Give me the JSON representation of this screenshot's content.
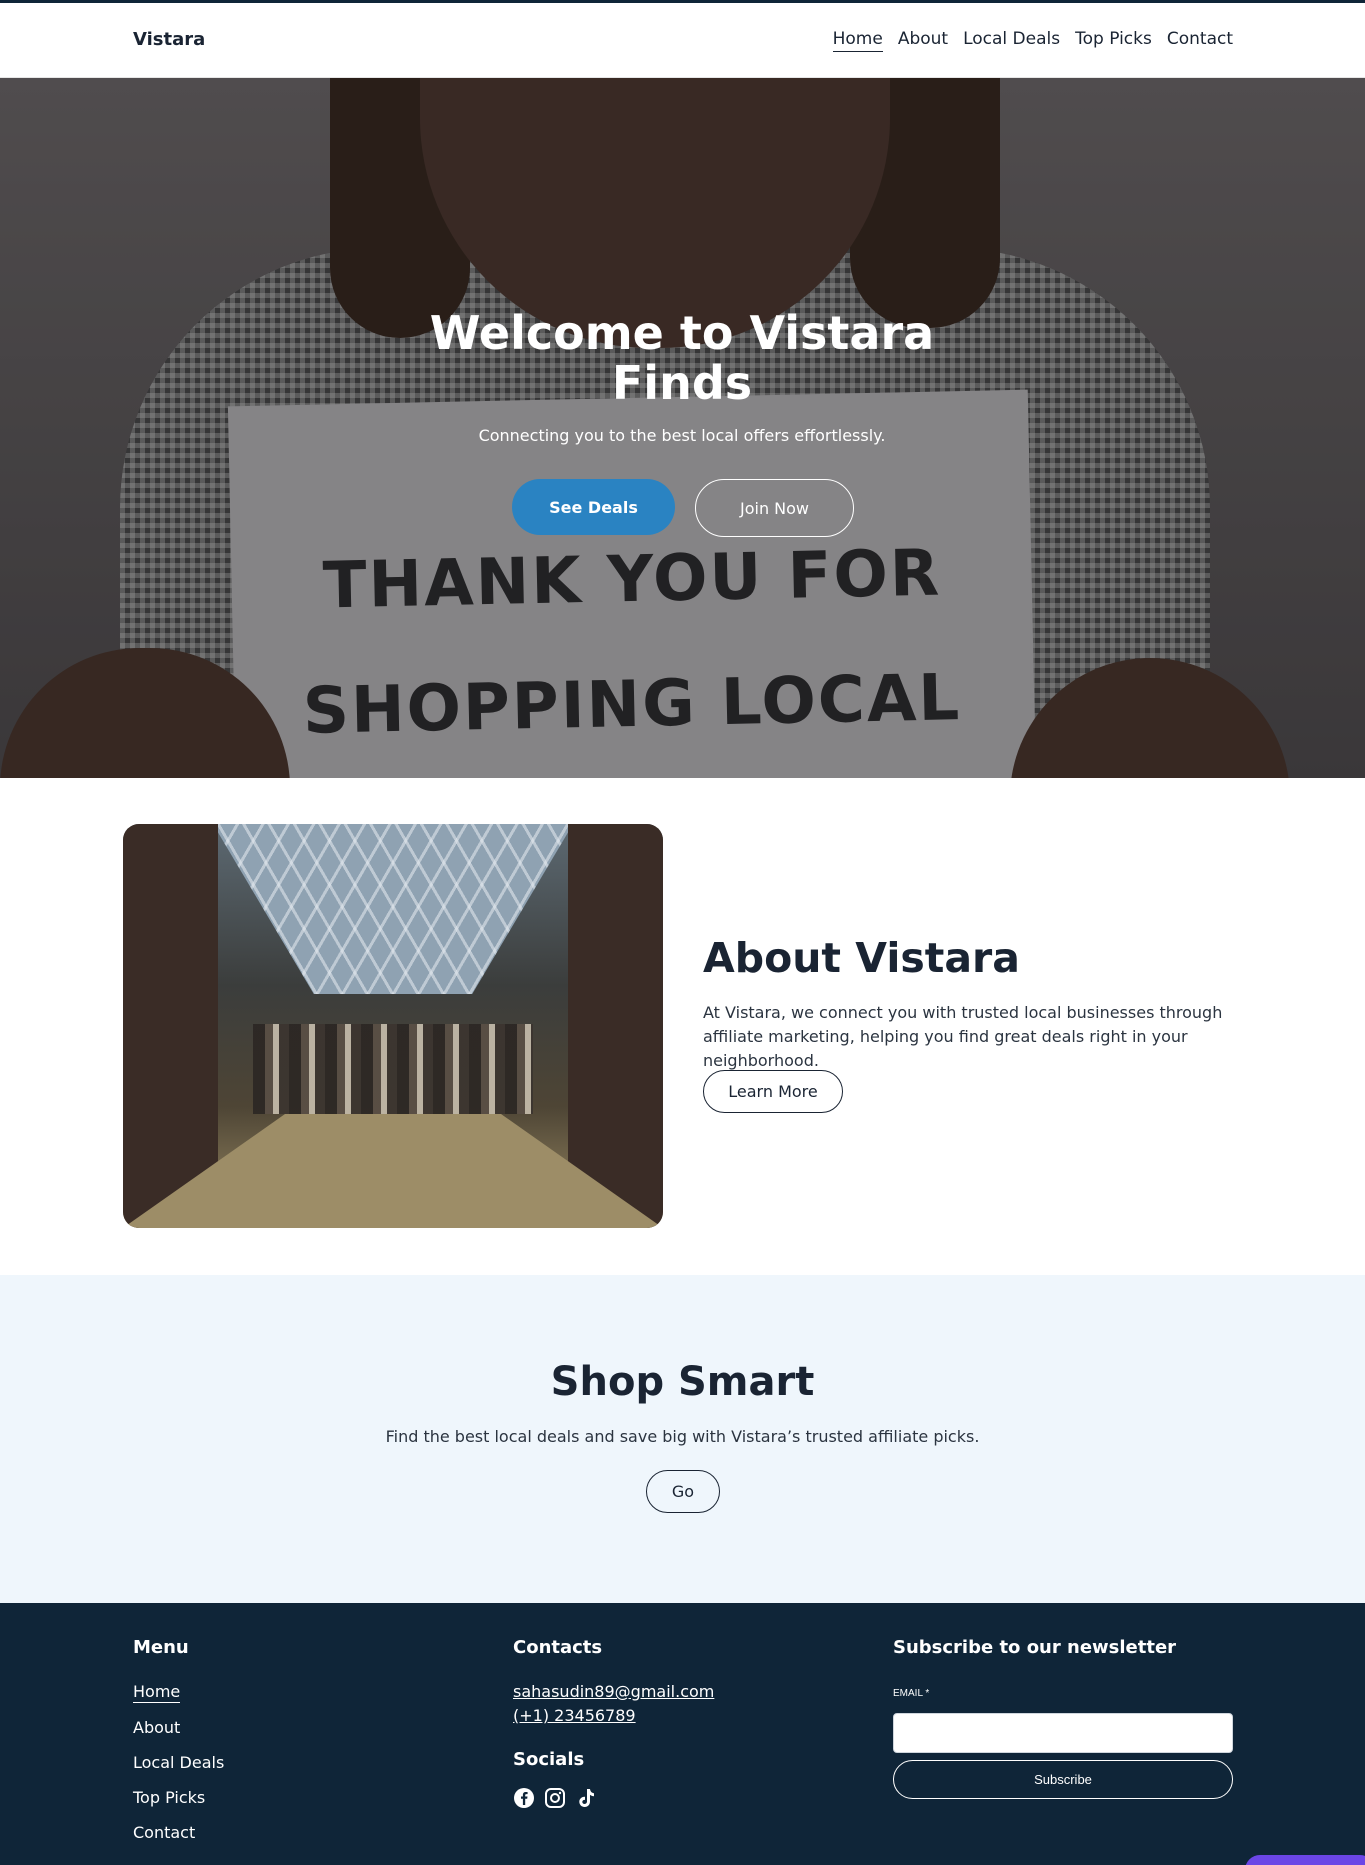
{
  "header": {
    "brand": "Vistara",
    "nav": [
      "Home",
      "About",
      "Local Deals",
      "Top Picks",
      "Contact"
    ],
    "active": "Home"
  },
  "hero": {
    "title": "Welcome to Vistara Finds",
    "subtitle": "Connecting you to the best local offers effortlessly.",
    "primary_button": "See Deals",
    "secondary_button": "Join Now",
    "sign_text_1": "THANK YOU FOR",
    "sign_text_2": "SHOPPING LOCAL"
  },
  "about": {
    "title": "About Vistara",
    "text": "At Vistara, we connect you with trusted local businesses through affiliate marketing, helping you find great deals right in your neighborhood.",
    "button": "Learn More"
  },
  "shop": {
    "title": "Shop Smart",
    "text": "Find the best local deals and save big with Vistara’s trusted affiliate picks.",
    "button": "Go"
  },
  "footer": {
    "menu_title": "Menu",
    "menu": [
      "Home",
      "About",
      "Local Deals",
      "Top Picks",
      "Contact"
    ],
    "contacts_title": "Contacts",
    "email": "sahasudin89@gmail.com",
    "phone": "(+1) 23456789",
    "socials_title": "Socials",
    "socials": [
      "facebook-icon",
      "instagram-icon",
      "tiktok-icon"
    ],
    "newsletter_title": "Subscribe to our newsletter",
    "email_label": "EMAIL *",
    "subscribe_button": "Subscribe"
  },
  "colors": {
    "accent": "#2a83c2",
    "footer_bg": "#0f2538",
    "section_bg": "#eff6fc",
    "chat": "#6b46e6"
  }
}
